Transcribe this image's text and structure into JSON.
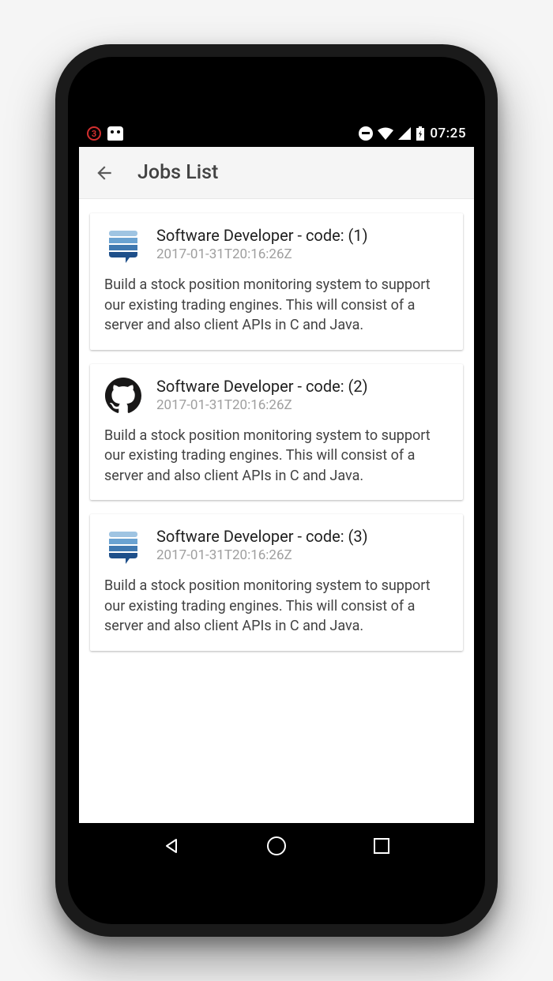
{
  "status_bar": {
    "notification_count": "3",
    "time": "07:25"
  },
  "app_bar": {
    "title": "Jobs List"
  },
  "jobs": [
    {
      "title": "Software Developer - code: (1)",
      "subtitle": "2017-01-31T20:16:26Z",
      "description": "Build a stock position monitoring system to support our existing trading engines. This will consist of a server and also client APIs in C and Java.",
      "icon": "stackexchange"
    },
    {
      "title": "Software Developer - code: (2)",
      "subtitle": "2017-01-31T20:16:26Z",
      "description": "Build a stock position monitoring system to support our existing trading engines. This will consist of a server and also client APIs in C and Java.",
      "icon": "github"
    },
    {
      "title": "Software Developer - code: (3)",
      "subtitle": "2017-01-31T20:16:26Z",
      "description": "Build a stock position monitoring system to support our existing trading engines. This will consist of a server and also client APIs in C and Java.",
      "icon": "stackexchange"
    }
  ]
}
